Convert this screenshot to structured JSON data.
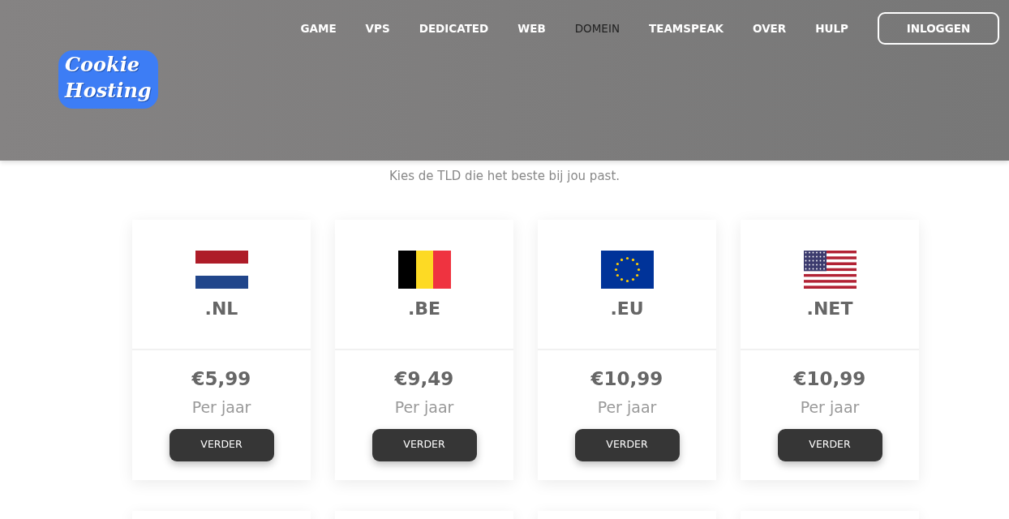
{
  "header": {
    "logo": [
      "Cookie",
      "Hosting"
    ],
    "nav": [
      {
        "label": "GAME",
        "selected": false
      },
      {
        "label": "VPS",
        "selected": false
      },
      {
        "label": "DEDICATED",
        "selected": false
      },
      {
        "label": "WEB",
        "selected": false
      },
      {
        "label": "DOMEIN",
        "selected": true
      },
      {
        "label": "TEAMSPEAK",
        "selected": false
      },
      {
        "label": "OVER",
        "selected": false
      },
      {
        "label": "HULP",
        "selected": false
      }
    ],
    "login_button": "INLOGGEN"
  },
  "intro": "Kies de TLD die het beste bij jou past.",
  "domains": [
    {
      "flag": {
        "kind": "nl"
      },
      "tld": ".NL",
      "price": "€5,99",
      "period": "Per jaar",
      "button": "VERDER"
    },
    {
      "flag": {
        "kind": "be"
      },
      "tld": ".BE",
      "price": "€9,49",
      "period": "Per jaar",
      "button": "VERDER"
    },
    {
      "flag": {
        "kind": "eu"
      },
      "tld": ".EU",
      "price": "€10,99",
      "period": "Per jaar",
      "button": "VERDER"
    },
    {
      "flag": {
        "kind": "us"
      },
      "tld": ".NET",
      "price": "€10,99",
      "period": "Per jaar",
      "button": "VERDER"
    }
  ]
}
